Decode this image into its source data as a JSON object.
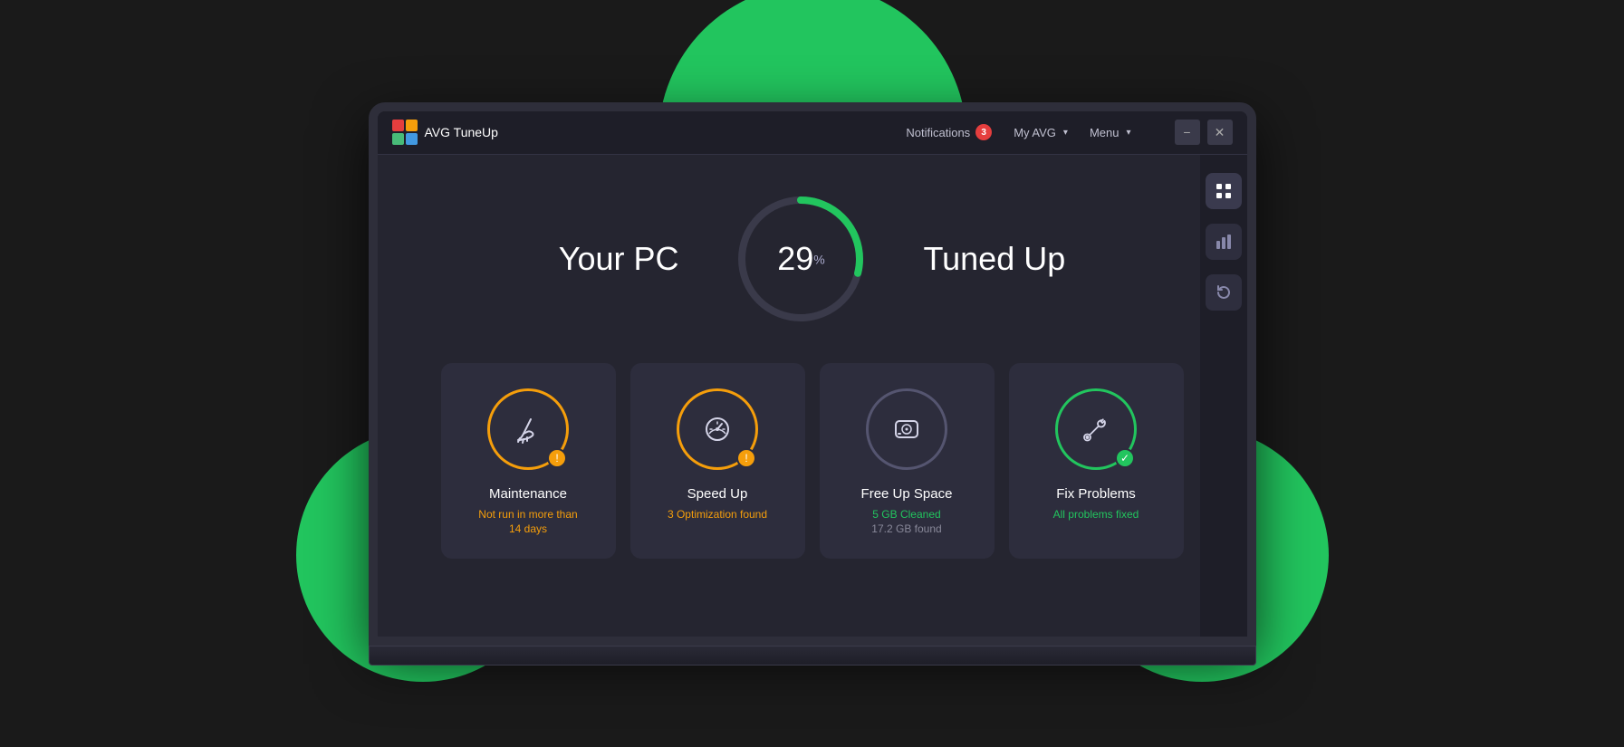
{
  "app": {
    "logo_text": "AVG  TuneUp",
    "title": "AVG TuneUp"
  },
  "titlebar": {
    "notifications_label": "Notifications",
    "notifications_count": "3",
    "my_avg_label": "My AVG",
    "menu_label": "Menu",
    "minimize_label": "−",
    "close_label": "✕"
  },
  "hero": {
    "your_pc_label": "Your PC",
    "tuned_up_label": "Tuned Up",
    "gauge_value": "29",
    "gauge_symbol": "%",
    "gauge_percent": 29
  },
  "side_panel": {
    "icons": [
      {
        "name": "grid-icon",
        "symbol": "⊞",
        "active": true
      },
      {
        "name": "bar-chart-icon",
        "symbol": "▐",
        "active": false
      },
      {
        "name": "refresh-icon",
        "symbol": "↺",
        "active": false
      }
    ]
  },
  "cards": [
    {
      "id": "maintenance",
      "title": "Maintenance",
      "subtitle_line1": "Not run in more than",
      "subtitle_line2": "14 days",
      "subtitle_color": "orange",
      "icon_color": "orange",
      "badge_type": "warning",
      "badge_symbol": "!"
    },
    {
      "id": "speed-up",
      "title": "Speed Up",
      "subtitle_line1": "3 Optimization found",
      "subtitle_line2": "",
      "subtitle_color": "orange",
      "icon_color": "orange",
      "badge_type": "warning",
      "badge_symbol": "!"
    },
    {
      "id": "free-up-space",
      "title": "Free Up Space",
      "subtitle_line1": "5 GB Cleaned",
      "subtitle_line2": "17.2 GB found",
      "subtitle_color": "green",
      "subtitle2_color": "gray",
      "icon_color": "gray",
      "badge_type": null
    },
    {
      "id": "fix-problems",
      "title": "Fix Problems",
      "subtitle_line1": "All problems fixed",
      "subtitle_line2": "",
      "subtitle_color": "green",
      "icon_color": "green",
      "badge_type": "success",
      "badge_symbol": "✓"
    }
  ],
  "colors": {
    "orange": "#f59e0b",
    "green": "#22c55e",
    "gray": "#555570",
    "bg_card": "#2d2d3d",
    "bg_main": "#252530"
  }
}
